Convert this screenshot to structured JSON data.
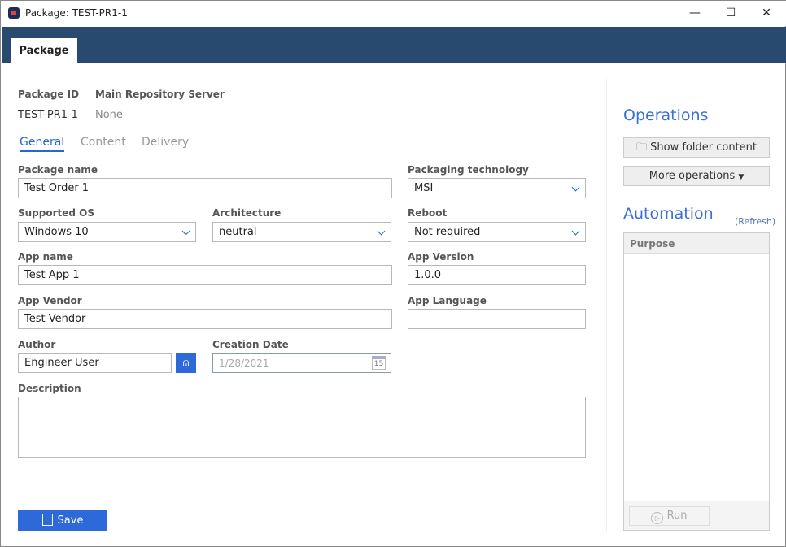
{
  "window": {
    "title": "Package: TEST-PR1-1",
    "minimize": "—",
    "maximize": "☐",
    "close": "✕"
  },
  "header": {
    "tab": "Package"
  },
  "meta": {
    "package_id_label": "Package ID",
    "package_id": "TEST-PR1-1",
    "server_label": "Main Repository Server",
    "server": "None"
  },
  "subtabs": [
    "General",
    "Content",
    "Delivery"
  ],
  "form": {
    "package_name": {
      "label": "Package name",
      "value": "Test Order 1"
    },
    "packaging_technology": {
      "label": "Packaging technology",
      "value": "MSI"
    },
    "supported_os": {
      "label": "Supported OS",
      "value": "Windows 10"
    },
    "architecture": {
      "label": "Architecture",
      "value": "neutral"
    },
    "reboot": {
      "label": "Reboot",
      "value": "Not required"
    },
    "app_name": {
      "label": "App name",
      "value": "Test App 1"
    },
    "app_version": {
      "label": "App Version",
      "value": "1.0.0"
    },
    "app_vendor": {
      "label": "App Vendor",
      "value": "Test Vendor"
    },
    "app_language": {
      "label": "App Language",
      "value": ""
    },
    "author": {
      "label": "Author",
      "value": "Engineer User"
    },
    "creation_date": {
      "label": "Creation Date",
      "value": "1/28/2021",
      "calendar_day": "15"
    },
    "description": {
      "label": "Description",
      "value": ""
    }
  },
  "save_label": "Save",
  "operations": {
    "title": "Operations",
    "show_folder": "Show folder content",
    "more": "More operations"
  },
  "automation": {
    "title": "Automation",
    "refresh": "(Refresh)",
    "column": "Purpose",
    "run": "Run"
  },
  "colors": {
    "accent": "#2d69d8",
    "header": "#274a6e"
  }
}
